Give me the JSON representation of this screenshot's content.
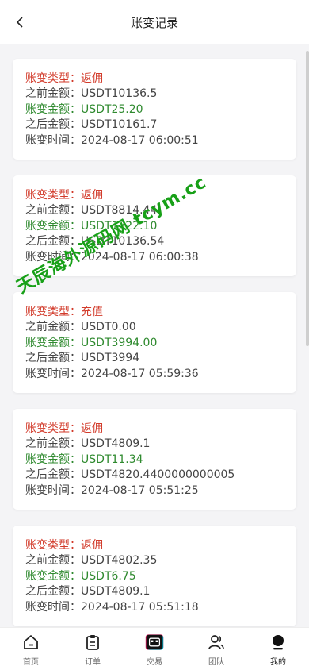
{
  "header": {
    "title": "账变记录"
  },
  "records": [
    {
      "type_label": "账变类型：",
      "type_value": "返佣",
      "before_label": "之前金额：",
      "before_value": "USDT10136.5",
      "change_label": "账变金额：",
      "change_value": "USDT25.20",
      "after_label": "之后金额：",
      "after_value": "USDT10161.7",
      "time_label": "账变时间：",
      "time_value": "2024-08-17 06:00:51"
    },
    {
      "type_label": "账变类型：",
      "type_value": "返佣",
      "before_label": "之前金额：",
      "before_value": "USDT8814.44",
      "change_label": "账变金额：",
      "change_value": "USDT1322.10",
      "after_label": "之后金额：",
      "after_value": "USDT10136.54",
      "time_label": "账变时间：",
      "time_value": "2024-08-17 06:00:38"
    },
    {
      "type_label": "账变类型：",
      "type_value": "充值",
      "before_label": "之前金额：",
      "before_value": "USDT0.00",
      "change_label": "账变金额：",
      "change_value": "USDT3994.00",
      "after_label": "之后金额：",
      "after_value": "USDT3994",
      "time_label": "账变时间：",
      "time_value": "2024-08-17 05:59:36"
    },
    {
      "type_label": "账变类型：",
      "type_value": "返佣",
      "before_label": "之前金额：",
      "before_value": "USDT4809.1",
      "change_label": "账变金额：",
      "change_value": "USDT11.34",
      "after_label": "之后金额：",
      "after_value": "USDT4820.4400000000005",
      "time_label": "账变时间：",
      "time_value": "2024-08-17 05:51:25"
    },
    {
      "type_label": "账变类型：",
      "type_value": "返佣",
      "before_label": "之前金额：",
      "before_value": "USDT4802.35",
      "change_label": "账变金额：",
      "change_value": "USDT6.75",
      "after_label": "之后金额：",
      "after_value": "USDT4809.1",
      "time_label": "账变时间：",
      "time_value": "2024-08-17 05:51:18"
    }
  ],
  "watermark": "天辰海外源码网 tcym.cc",
  "tabbar": {
    "home": "首页",
    "orders": "订单",
    "trade": "交易",
    "team": "团队",
    "mine": "我的"
  },
  "colors": {
    "type": "#d23a2a",
    "change": "#2f8a2f",
    "text": "#444444",
    "watermark": "#18a018"
  }
}
